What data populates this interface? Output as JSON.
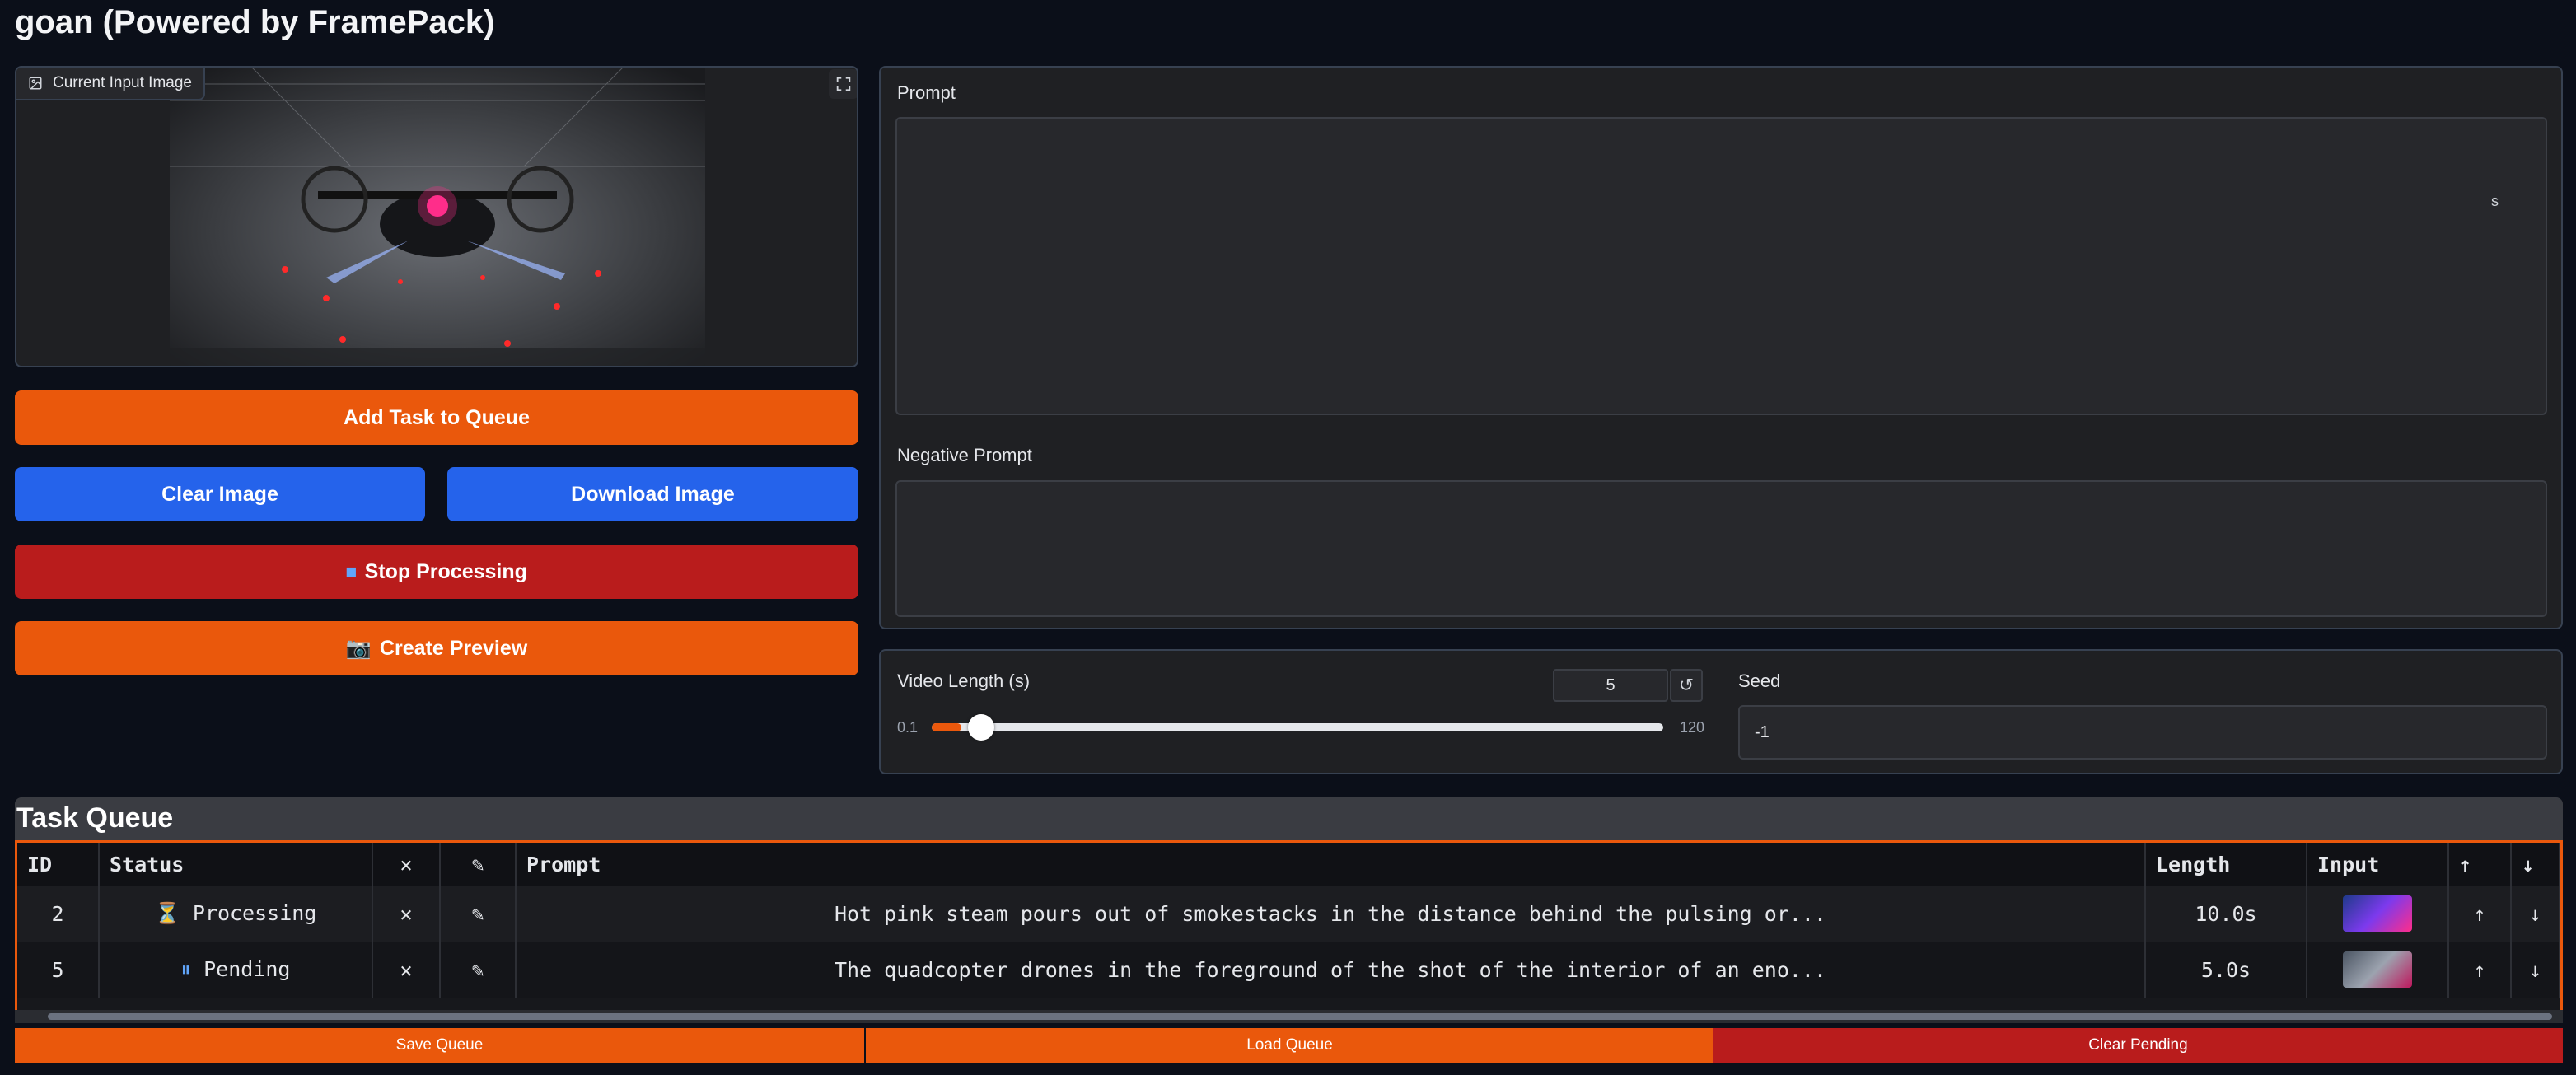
{
  "app": {
    "title": "goan (Powered by FramePack)"
  },
  "image_panel": {
    "label": "Current Input Image",
    "icon": "image-icon",
    "fullscreen_icon": "fullscreen-icon"
  },
  "buttons": {
    "add_task": "Add Task to Queue",
    "clear_image": "Clear Image",
    "download_image": "Download Image",
    "stop_processing": "Stop Processing",
    "stop_icon": "⏹",
    "create_preview": "Create Preview",
    "preview_icon": "📷"
  },
  "prompt": {
    "label": "Prompt",
    "value": "",
    "counter": "s"
  },
  "negative_prompt": {
    "label": "Negative Prompt",
    "value": ""
  },
  "video_length": {
    "label": "Video Length (s)",
    "value": "5",
    "min": "0.1",
    "max": "120",
    "reset_icon": "↺",
    "fraction": 0.041
  },
  "seed": {
    "label": "Seed",
    "value": "-1"
  },
  "task_queue": {
    "title": "Task Queue",
    "columns": [
      "ID",
      "Status",
      "✕",
      "✎",
      "Prompt",
      "Length",
      "Input",
      "↑",
      "↓"
    ],
    "rows": [
      {
        "id": "2",
        "status_icon": "⏳",
        "status": "Processing",
        "remove": "✕",
        "edit": "✎",
        "prompt": "Hot pink steam pours out of smokestacks in the distance behind the pulsing or...",
        "length": "10.0s",
        "up": "↑",
        "down": "↓"
      },
      {
        "id": "5",
        "status_icon": "⏸",
        "status": "Pending",
        "remove": "✕",
        "edit": "✎",
        "prompt": "The quadcopter drones in the foreground of the shot of the interior of an eno...",
        "length": "5.0s",
        "up": "↑",
        "down": "↓"
      }
    ]
  },
  "queue_buttons": {
    "save": "Save Queue",
    "load": "Load Queue",
    "clear_pending": "Clear Pending"
  },
  "colors": {
    "accent": "#ea580c",
    "primary": "#2563eb",
    "danger": "#b91c1c",
    "background": "#0b0f19"
  }
}
